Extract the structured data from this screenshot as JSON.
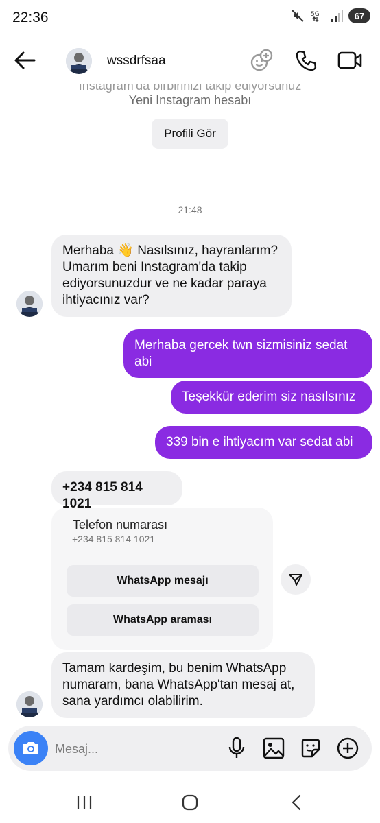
{
  "status_bar": {
    "time": "22:36",
    "battery": "67"
  },
  "header": {
    "username": "wssdrfsaa"
  },
  "profile": {
    "line1": "Instagram'da birbirinizi takip ediyorsunuz",
    "line2": "Yeni Instagram hesabı",
    "button": "Profili Gör"
  },
  "conversation": {
    "timestamp": "21:48",
    "msg1": "Merhaba 👋 Nasılsınız, hayranlarım? Umarım beni Instagram'da takip ediyorsunuzdur ve ne kadar paraya ihtiyacınız var?",
    "out1": "Merhaba gercek twn sizmisiniz sedat abi",
    "out2": "Teşekkür ederim siz nasılsınız",
    "out3": "339 bin e ihtiyacım var sedat abi",
    "phone_msg": "+234 815 814 1021",
    "card": {
      "title": "Telefon numarası",
      "number": "+234 815 814 1021",
      "btn_message": "WhatsApp mesajı",
      "btn_call": "WhatsApp araması"
    },
    "msg_last": "Tamam kardeşim, bu benim WhatsApp numaram, bana WhatsApp'tan mesaj at, sana yardımcı olabilirim."
  },
  "composer": {
    "placeholder": "Mesaj..."
  },
  "colors": {
    "outgoing": "#8a2be2",
    "incoming": "#efeff1",
    "camera": "#3b82f6"
  },
  "icons": [
    "back-arrow-icon",
    "effects-icon",
    "phone-icon",
    "video-icon",
    "camera-icon",
    "mic-icon",
    "gallery-icon",
    "sticker-icon",
    "plus-icon",
    "share-icon",
    "recents-icon",
    "home-icon",
    "back-nav-icon"
  ]
}
